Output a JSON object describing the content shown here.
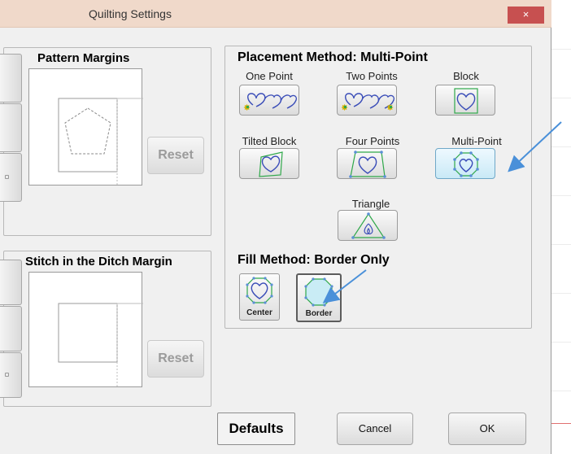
{
  "window": {
    "title": "Quilting Settings",
    "close_label": "×"
  },
  "pattern_margins": {
    "title": "Pattern Margins",
    "reset_label": "Reset"
  },
  "stitch_ditch": {
    "title": "Stitch in the Ditch Margin",
    "reset_label": "Reset"
  },
  "placement": {
    "title": "Placement Method: Multi-Point",
    "selected": "Multi-Point",
    "methods": [
      {
        "label": "One Point",
        "icon": "one-point-hearts-icon"
      },
      {
        "label": "Two Points",
        "icon": "two-points-hearts-icon"
      },
      {
        "label": "Block",
        "icon": "block-heart-icon"
      },
      {
        "label": "Tilted Block",
        "icon": "tilted-block-heart-icon"
      },
      {
        "label": "Four Points",
        "icon": "four-points-heart-icon"
      },
      {
        "label": "Multi-Point",
        "icon": "multi-point-heart-icon"
      },
      {
        "label": "Triangle",
        "icon": "triangle-icon"
      }
    ]
  },
  "fill": {
    "title": "Fill Method: Border Only",
    "selected": "Border",
    "options": [
      {
        "label": "Center",
        "icon": "center-fill-icon"
      },
      {
        "label": "Border",
        "icon": "border-fill-icon"
      }
    ]
  },
  "footer": {
    "defaults_label": "Defaults",
    "cancel_label": "Cancel",
    "ok_label": "OK"
  },
  "colors": {
    "accent_green": "#2fa84a",
    "accent_blue": "#5b8fd6",
    "shape_purple": "#3a4db8",
    "arrow": "#4a90d9",
    "close_red": "#c75050"
  }
}
